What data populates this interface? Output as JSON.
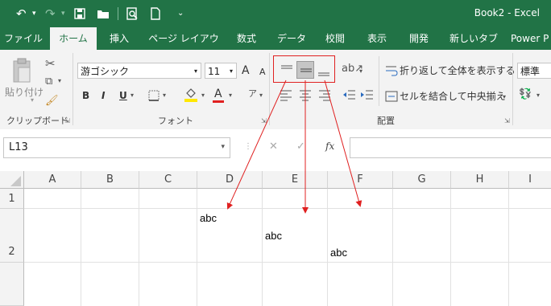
{
  "quick_access": {
    "undo_icon": "↶",
    "redo_icon": "↷",
    "save_icon": "💾",
    "open_icon": "▭",
    "preview_icon": "🔍",
    "new_icon": "▯",
    "customize_icon": "⌄"
  },
  "window_title": "Book2 - Excel",
  "tabs": [
    "ファイル",
    "ホーム",
    "挿入",
    "ページ レイアウト",
    "数式",
    "データ",
    "校閲",
    "表示",
    "開発",
    "新しいタブ",
    "Power P"
  ],
  "active_tab": "ホーム",
  "clipboard": {
    "paste_label": "貼り付け",
    "group_label": "クリップボード"
  },
  "font": {
    "name": "游ゴシック",
    "size": "11",
    "grow": "A",
    "shrink": "A",
    "bold": "B",
    "italic": "I",
    "underline": "U",
    "group_label": "フォント"
  },
  "alignment": {
    "wrap_text": "折り返して全体を表示する",
    "merge_center": "セルを結合して中央揃え",
    "group_label": "配置"
  },
  "number": {
    "format": "標準"
  },
  "formula_bar": {
    "name_box": "L13",
    "cancel": "✕",
    "enter": "✓",
    "fx": "fx",
    "formula": ""
  },
  "columns": [
    "A",
    "B",
    "C",
    "D",
    "E",
    "F",
    "G",
    "H",
    "I"
  ],
  "rows": [
    "1",
    "2"
  ],
  "cells": {
    "d2": "abc",
    "e2": "abc",
    "f2": "abc"
  },
  "colors": {
    "excel_green": "#217346",
    "annotation_red": "#e02020"
  }
}
